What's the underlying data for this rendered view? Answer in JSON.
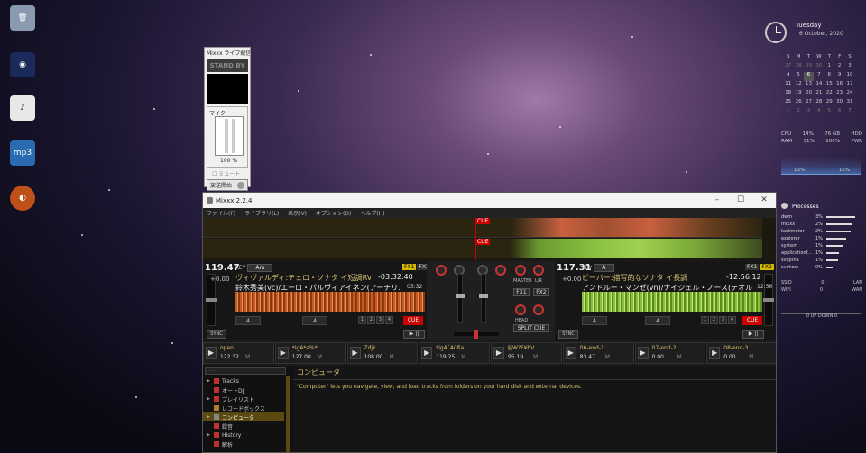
{
  "broadcast": {
    "title": "Mixxx ライブ配信",
    "status": "STAND BY",
    "mic_label": "マイク",
    "percent": "100 %",
    "mute": "ミュート",
    "start": "放送開始"
  },
  "mixxx": {
    "title": "Mixxx 2.2.4",
    "menu": [
      "ファイル(F)",
      "ライブラリ(L)",
      "表示(V)",
      "オプション(O)",
      "ヘルプ(H)"
    ],
    "overview_cue": "CUE",
    "deck1": {
      "bpm": "119.47",
      "delta": "+0.00",
      "key_label": "KEY",
      "key": "Am",
      "fx1": "FX1",
      "fx2": "FX2",
      "title": "ヴィヴァルディ:チェロ・ソナタ イ短調RV43第2...",
      "remaining": "-03:32.40",
      "artist": "鈴木秀美(vc)/エーロ・パルヴィアイネン(アーチリ...",
      "duration": "03:32",
      "loop1": "4",
      "loop2": "4",
      "hotcues": [
        "1",
        "2",
        "3",
        "4"
      ],
      "cue": "CUE",
      "sync": "SYNC",
      "play": "▶ ||"
    },
    "deck2": {
      "bpm": "117.31",
      "delta": "+0.00",
      "key_label": "KEY",
      "key": "A",
      "fx1": "FX1",
      "fx2": "FX2",
      "title": "ビーバー:描写的なソナタ イ長調",
      "remaining": "-12:56.12",
      "artist": "アンドルー・マンゼ(vn)/ナイジェル・ノース(テオル...",
      "duration": "12:56",
      "loop1": "4",
      "loop2": "4",
      "hotcues": [
        "1",
        "2",
        "3",
        "4"
      ],
      "cue": "CUE",
      "sync": "SYNC",
      "play": "▶ ||"
    },
    "mixer": {
      "fx1": "FX1",
      "fx2": "FX2",
      "master_label": "MASTER",
      "lr_label": "L/R",
      "head_label": "HEAD",
      "split_cue": "SPLIT CUE"
    },
    "samplers": [
      {
        "name": "open",
        "bpm": "122.32"
      },
      {
        "name": "*igA*a%*",
        "bpm": "127.00"
      },
      {
        "name": "Zdjk",
        "bpm": "108.00"
      },
      {
        "name": "*igA´Aüßa",
        "bpm": "119.25"
      },
      {
        "name": "§|W?F¥bV",
        "bpm": "95.19"
      },
      {
        "name": "06-end-1",
        "bpm": "83.47"
      },
      {
        "name": "07-end-2",
        "bpm": "0.00"
      },
      {
        "name": "08-end-3",
        "bpm": "0.00"
      }
    ],
    "sampler_m": "M",
    "library": {
      "search_placeholder": "- - -",
      "tree": [
        {
          "label": "Tracks",
          "expand": "▶"
        },
        {
          "label": "オートDJ",
          "expand": ""
        },
        {
          "label": "プレイリスト",
          "expand": "▶"
        },
        {
          "label": "レコードボックス",
          "expand": ""
        },
        {
          "label": "コンピュータ",
          "expand": "▶"
        },
        {
          "label": "録音",
          "expand": ""
        },
        {
          "label": "History",
          "expand": "▶"
        },
        {
          "label": "解析",
          "expand": ""
        }
      ],
      "selected_index": 4,
      "heading": "コンピュータ",
      "description": "\"Computer\" lets you navigate, view, and load tracks from folders on your hard disk and external devices."
    }
  },
  "rainmeter": {
    "day": "Tuesday",
    "date": "6 October, 2020",
    "calendar_header": [
      "S",
      "M",
      "T",
      "W",
      "T",
      "F",
      "S"
    ],
    "calendar_rows": [
      [
        "27",
        "28",
        "29",
        "30",
        "1",
        "2",
        "3"
      ],
      [
        "4",
        "5",
        "6",
        "7",
        "8",
        "9",
        "10"
      ],
      [
        "11",
        "12",
        "13",
        "14",
        "15",
        "16",
        "17"
      ],
      [
        "18",
        "19",
        "20",
        "21",
        "22",
        "23",
        "24"
      ],
      [
        "25",
        "26",
        "27",
        "28",
        "29",
        "30",
        "31"
      ],
      [
        "1",
        "2",
        "3",
        "4",
        "5",
        "6",
        "7"
      ]
    ],
    "cpu_label": "CPU",
    "cpu_val": "14%",
    "hdd_val": "76 GB",
    "hdd_label": "HDD",
    "ram_label": "RAM",
    "ram_val": "31%",
    "pwr_val": "100%",
    "pwr_label": "PWR",
    "graph_left": "13%",
    "graph_right": "15%",
    "processes_title": "Processes",
    "processes": [
      {
        "name": "dwm",
        "pct": "3%",
        "bar": 0.9
      },
      {
        "name": "mixxx",
        "pct": "2%",
        "bar": 0.8
      },
      {
        "name": "taskmeter",
        "pct": "2%",
        "bar": 0.75
      },
      {
        "name": "explorer",
        "pct": "1%",
        "bar": 0.6
      },
      {
        "name": "system",
        "pct": "1%",
        "bar": 0.5
      },
      {
        "name": "applicationf...",
        "pct": "1%",
        "bar": 0.4
      },
      {
        "name": "svcptna",
        "pct": "1%",
        "bar": 0.35
      },
      {
        "name": "svchost",
        "pct": "0%",
        "bar": 0.2
      }
    ],
    "ssid_label": "SSID",
    "ssid_val": "0",
    "lan_label": "LAN",
    "wifi_label": "WIFI",
    "wifi_val": "0",
    "wan_label": "WAN",
    "net_bottom": "0 UP DOWN 0"
  }
}
